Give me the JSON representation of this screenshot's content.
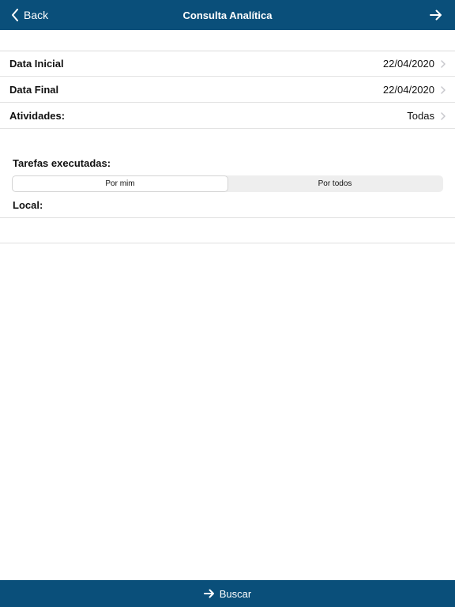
{
  "nav": {
    "back_label": "Back",
    "title": "Consulta Analítica",
    "back_icon": "chevron-left-icon",
    "forward_icon": "arrow-right-icon"
  },
  "filters": [
    {
      "label": "Data Inicial",
      "value": "22/04/2020"
    },
    {
      "label": "Data Final",
      "value": "22/04/2020"
    },
    {
      "label": "Atividades:",
      "value": "Todas"
    }
  ],
  "tasks": {
    "label": "Tarefas executadas:",
    "options": [
      "Por mim",
      "Por todos"
    ],
    "selected": "Por mim"
  },
  "local": {
    "label": "Local:"
  },
  "search": {
    "label": "Buscar",
    "icon": "arrow-right-icon"
  },
  "colors": {
    "bar": "#0a4f7a",
    "chevron": "#c7c7cc"
  }
}
